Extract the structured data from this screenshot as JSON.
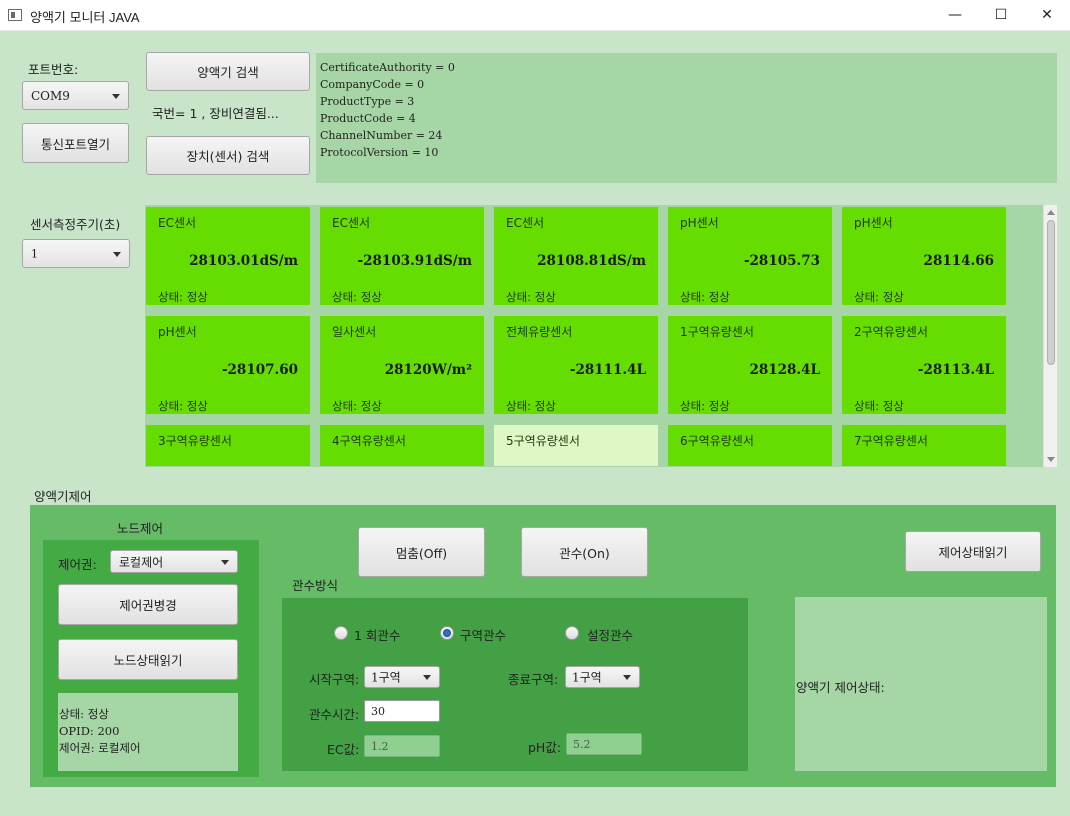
{
  "window": {
    "title": "양액기 모니터 JAVA",
    "minimize": "—",
    "maximize": "☐",
    "close": "✕"
  },
  "connection": {
    "port_label": "포트번호:",
    "port_value": "COM9",
    "open_port": "통신포트열기",
    "search_device": "양액기 검색",
    "status_text": "국번= 1 , 장비연결됨...",
    "search_sensor": "장치(센서) 검색"
  },
  "device_info": [
    "CertificateAuthority = 0",
    "CompanyCode = 0",
    "ProductType = 3",
    "ProductCode = 4",
    "ChannelNumber = 24",
    "ProtocolVersion = 10"
  ],
  "measure": {
    "label": "센서측정주기(초)",
    "value": "1"
  },
  "sensors": [
    {
      "name": "EC센서",
      "value": "28103.01dS/m",
      "status": "상태: 정상"
    },
    {
      "name": "EC센서",
      "value": "-28103.91dS/m",
      "status": "상태: 정상"
    },
    {
      "name": "EC센서",
      "value": "28108.81dS/m",
      "status": "상태: 정상"
    },
    {
      "name": "pH센서",
      "value": "-28105.73",
      "status": "상태: 정상"
    },
    {
      "name": "pH센서",
      "value": "28114.66",
      "status": "상태: 정상"
    },
    {
      "name": "pH센서",
      "value": "-28107.60",
      "status": "상태: 정상"
    },
    {
      "name": "일사센서",
      "value": "28120W/m²",
      "status": "상태: 정상"
    },
    {
      "name": "전체유량센서",
      "value": "-28111.4L",
      "status": "상태: 정상"
    },
    {
      "name": "1구역유량센서",
      "value": "28128.4L",
      "status": "상태: 정상"
    },
    {
      "name": "2구역유량센서",
      "value": "-28113.4L",
      "status": "상태: 정상"
    },
    {
      "name": "3구역유량센서"
    },
    {
      "name": "4구역유량센서"
    },
    {
      "name": "5구역유량센서"
    },
    {
      "name": "6구역유량센서"
    },
    {
      "name": "7구역유량센서"
    }
  ],
  "control": {
    "section_title": "양액기제어",
    "node": {
      "title": "노드제어",
      "authority_label": "제어권:",
      "authority_value": "로컬제어",
      "change_btn": "제어권병경",
      "read_btn": "노드상태읽기",
      "status": [
        "상태: 정상",
        "OPID: 200",
        "제어권: 로컬제어"
      ]
    },
    "stop_btn": "멈춤(Off)",
    "on_btn": "관수(On)",
    "read_state_btn": "제어상태읽기",
    "irrigation": {
      "title": "관수방식",
      "options": [
        "1 회관수",
        "구역관수",
        "설정관수"
      ],
      "selected": "구역관수",
      "start_label": "시작구역:",
      "start_value": "1구역",
      "end_label": "종료구역:",
      "end_value": "1구역",
      "time_label": "관수시간:",
      "time_value": "30",
      "ec_label": "EC값:",
      "ec_value": "1.2",
      "ph_label": "pH값:",
      "ph_value": "5.2"
    },
    "state_label": "양액기 제어상태:"
  },
  "colors": {
    "tile_green": "#66dd00",
    "tile_light": "#dff7c4",
    "panel_green": "#44aa44",
    "background": "#c9e5c9"
  }
}
